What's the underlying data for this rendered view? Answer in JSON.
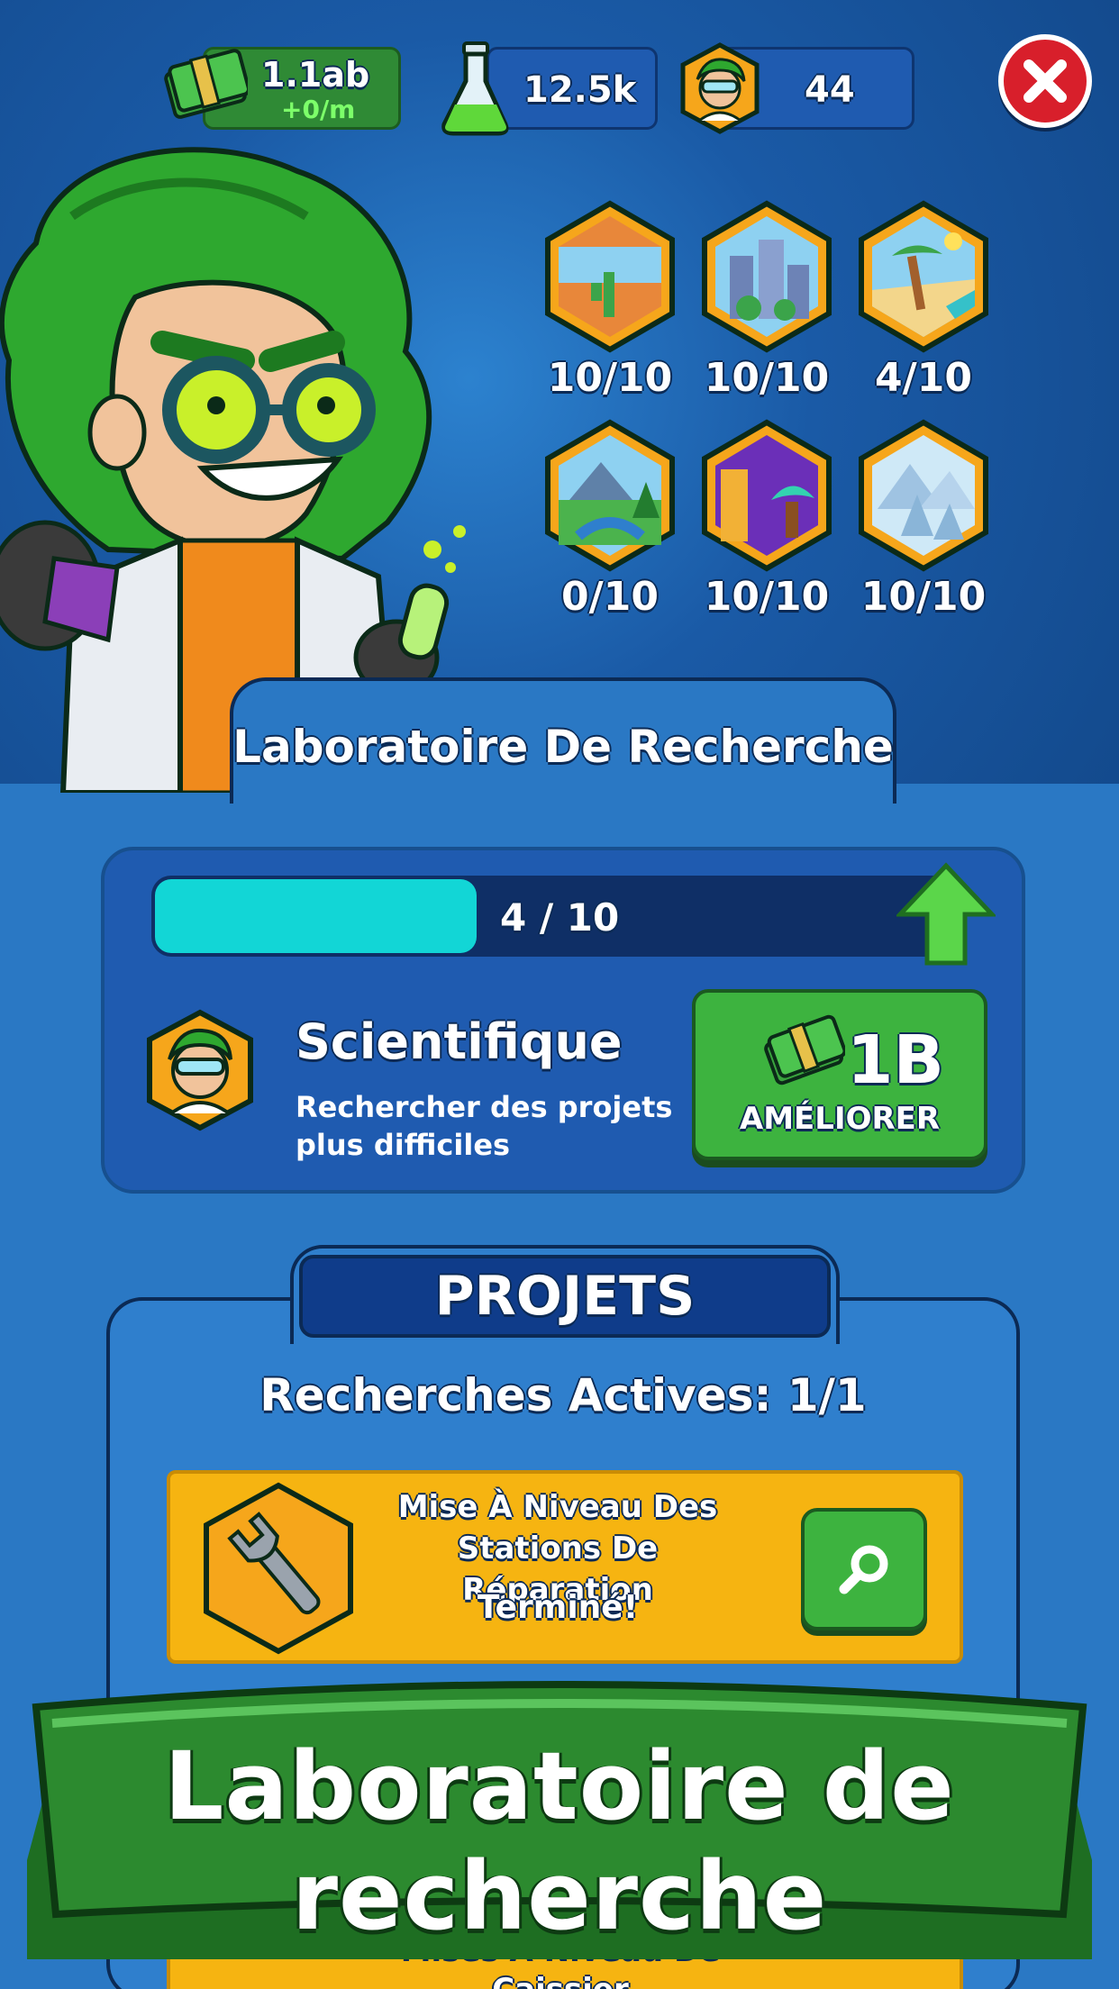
{
  "topbar": {
    "money_value": "1.1ab",
    "money_rate": "+0/m",
    "flask_value": "12.5k",
    "scientists_value": "44"
  },
  "regions": [
    {
      "name": "desert-region",
      "count": "10/10"
    },
    {
      "name": "city-region",
      "count": "10/10"
    },
    {
      "name": "beach-region",
      "count": "4/10"
    },
    {
      "name": "forest-region",
      "count": "0/10"
    },
    {
      "name": "neon-city-region",
      "count": "10/10"
    },
    {
      "name": "snow-region",
      "count": "10/10"
    }
  ],
  "panel_title": "Laboratoire De Recherche",
  "upgrade": {
    "progress_text": "4 / 10",
    "progress_fraction": 0.4,
    "title": "Scientifique",
    "description": "Rechercher des projets plus difficiles",
    "price": "1B",
    "button_label": "AMÉLIORER"
  },
  "projects": {
    "header": "PROJETS",
    "active_label": "Recherches Actives: 1/1",
    "items": [
      {
        "title": "Mise À Niveau Des Stations De Réparation",
        "status": "Terminé!"
      }
    ],
    "next_item_partial": "Mises À Niveau De Caissier"
  },
  "banner_text": "Laboratoire de recherche",
  "colors": {
    "accent_green": "#3db33f",
    "progress_fill": "#12d6d6",
    "card_yellow": "#f6b411",
    "close_red": "#d81f2b"
  }
}
